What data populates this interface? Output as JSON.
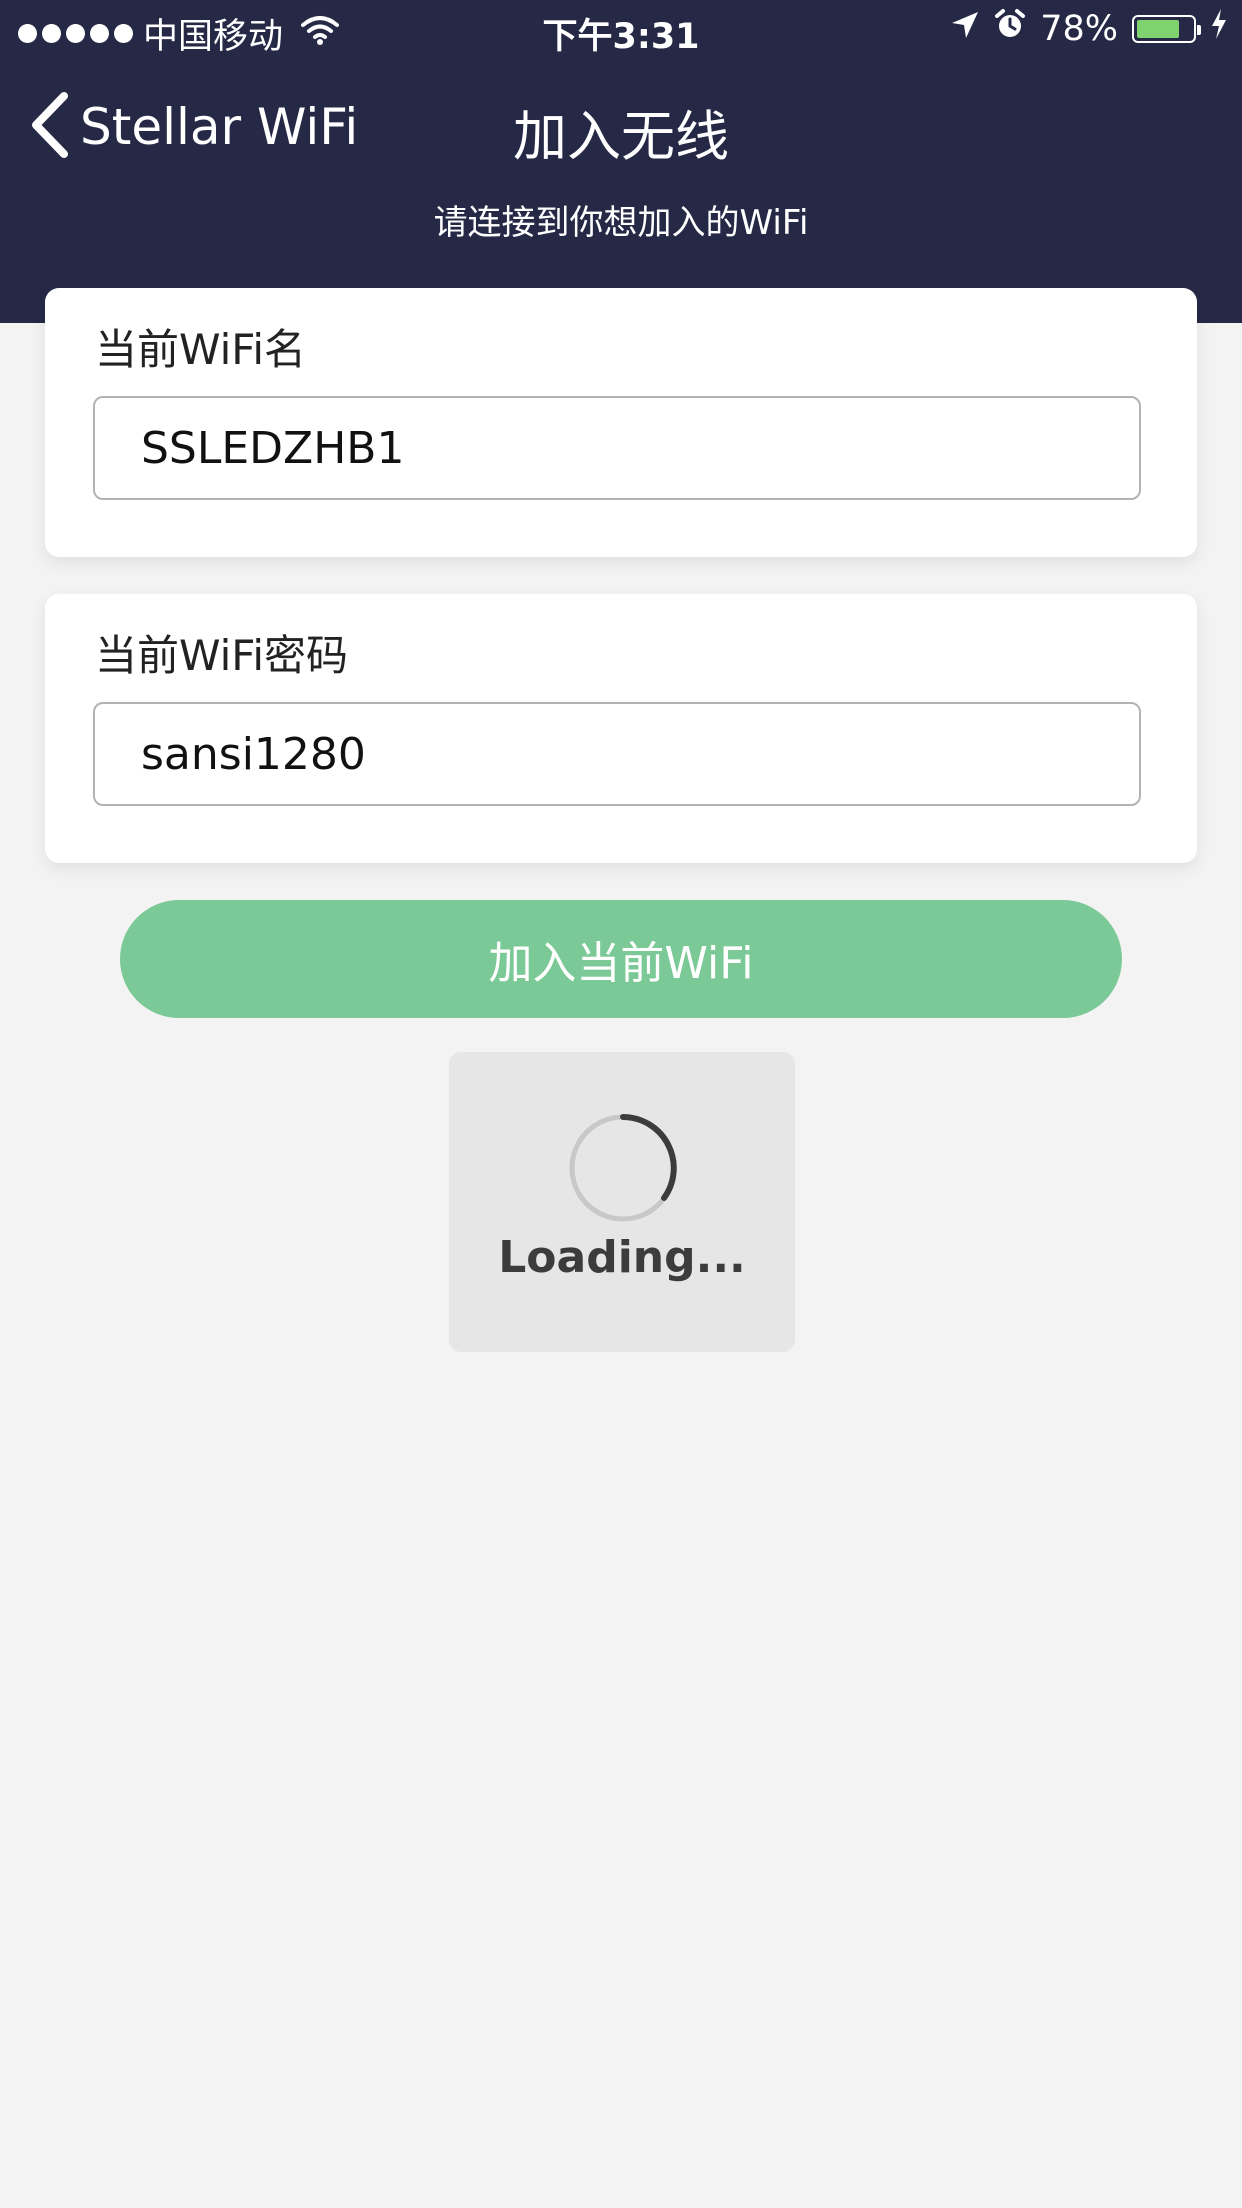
{
  "status_bar": {
    "carrier": "中国移动",
    "time": "下午3:31",
    "battery_percent": "78%",
    "battery_level": 0.78,
    "icons": [
      "signal-dots-icon",
      "wifi-icon",
      "location-arrow-icon",
      "alarm-icon",
      "battery-icon",
      "charging-bolt-icon"
    ]
  },
  "nav": {
    "back_label": "Stellar WiFi",
    "title": "加入无线",
    "subtitle": "请连接到你想加入的WiFi"
  },
  "form": {
    "ssid_label": "当前WiFi名",
    "ssid_value": "SSLEDZHB1",
    "password_label": "当前WiFi密码",
    "password_value": "sansi1280"
  },
  "join_button_label": "加入当前WiFi",
  "loading_text": "Loading...",
  "colors": {
    "header_bg": "#262946",
    "page_bg": "#f3f3f3",
    "button_bg": "#7bc996",
    "battery_fill": "#7ed36f"
  }
}
